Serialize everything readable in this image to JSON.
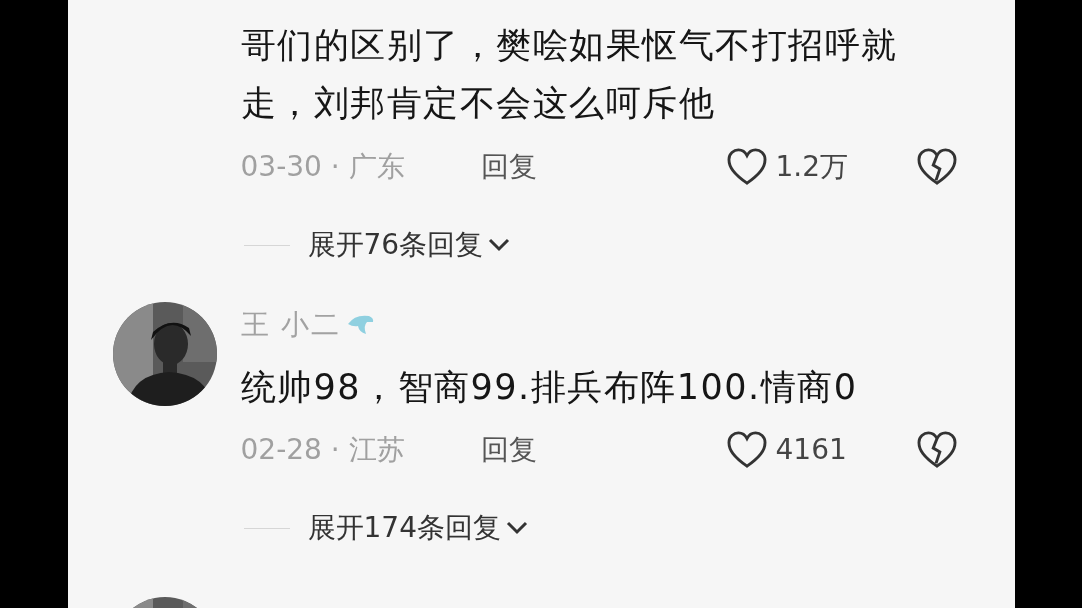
{
  "comments": [
    {
      "lines": [
        "哥们的区别了，樊哙如果怄气不打招呼就",
        "走，刘邦肯定不会这么呵斥他"
      ],
      "date_region": "03-30 · 广东",
      "reply": "回复",
      "likes": "1.2万",
      "expand": "展开76条回复"
    },
    {
      "avatar": {
        "kind": "picture"
      },
      "author": "王 小二",
      "lines": [
        "统帅98，智商99.排兵布阵100.情商0"
      ],
      "date_region": "02-28 · 江苏",
      "reply": "回复",
      "likes": "4161",
      "expand": "展开174条回复"
    },
    {
      "avatar": {
        "kind": "picture"
      }
    }
  ]
}
